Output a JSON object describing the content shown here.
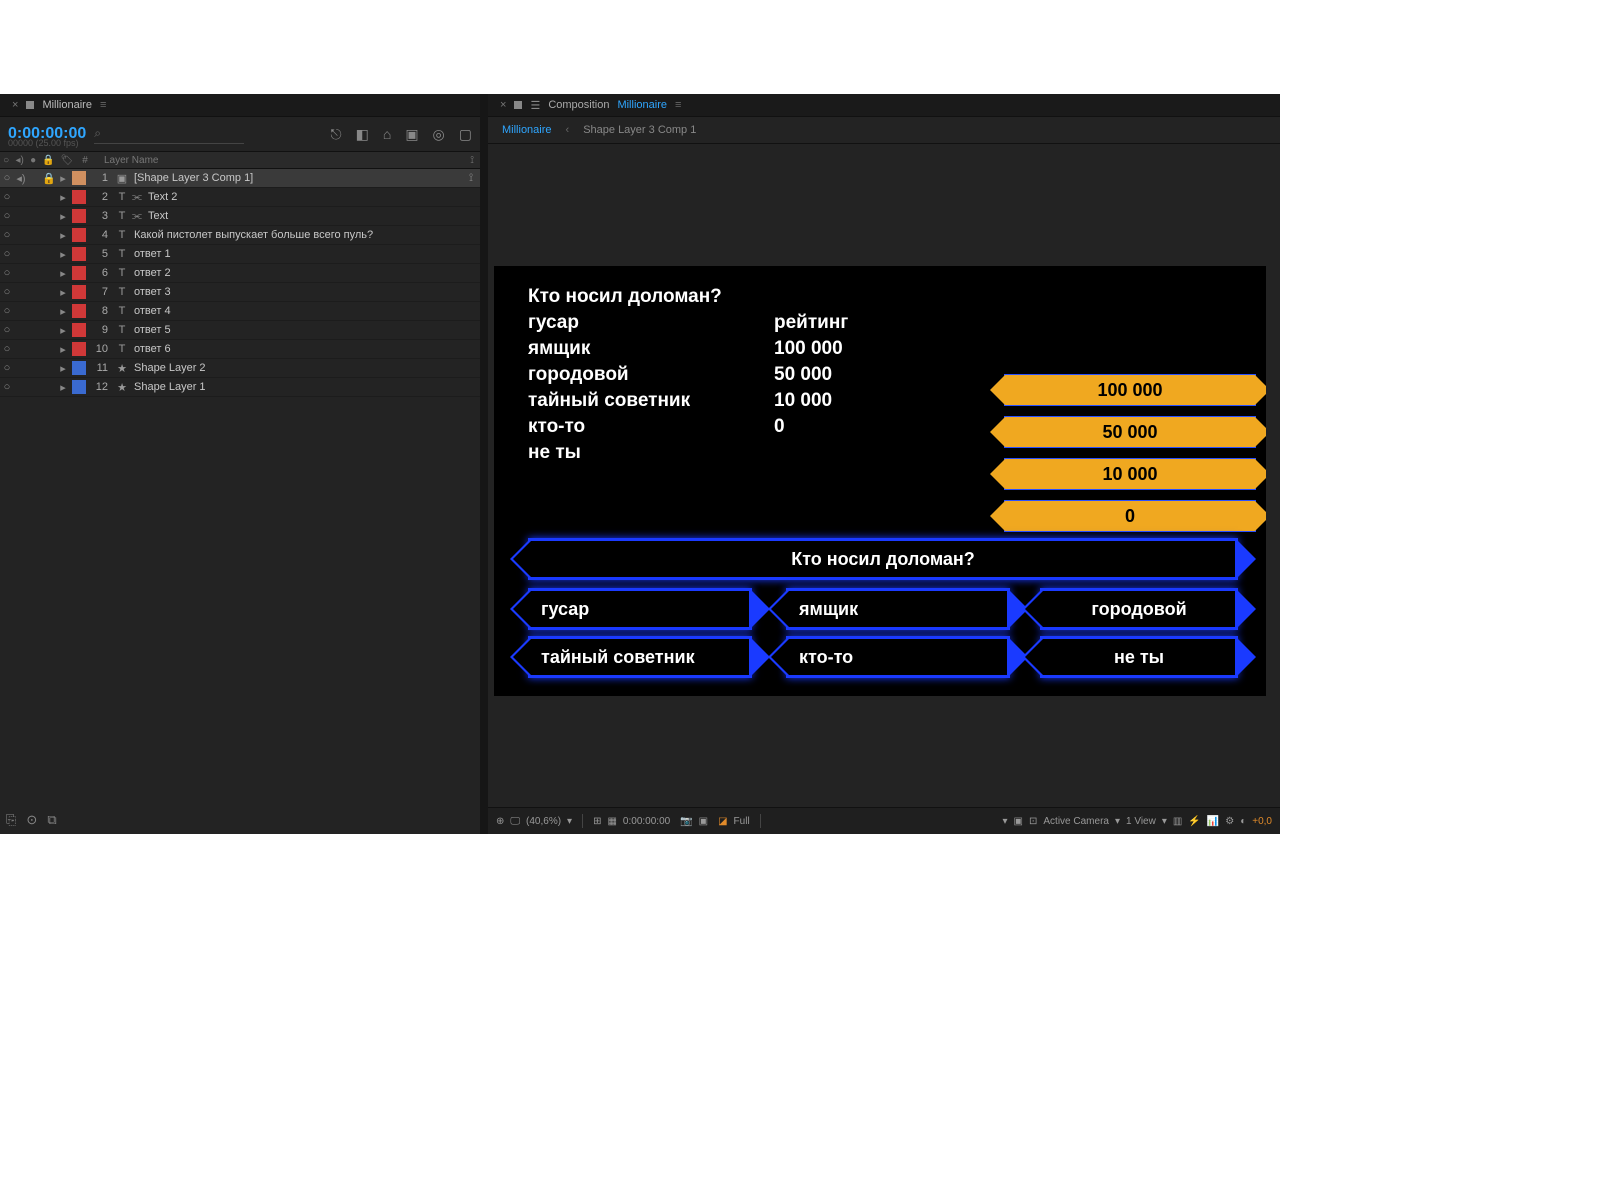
{
  "timeline": {
    "tab_name": "Millionaire",
    "timecode": "0:00:00:00",
    "fps": "00000 (25.00 fps)",
    "search_placeholder": "",
    "col_layer_name": "Layer Name",
    "col_idx": "#",
    "layers": [
      {
        "idx": "1",
        "name": "[Shape Layer 3 Comp 1]",
        "swatch": "sw-peach",
        "type": "comp",
        "link": ""
      },
      {
        "idx": "2",
        "name": "Text 2",
        "swatch": "sw-red",
        "type": "text",
        "link": "link"
      },
      {
        "idx": "3",
        "name": "Text",
        "swatch": "sw-red",
        "type": "text",
        "link": "link"
      },
      {
        "idx": "4",
        "name": "Какой пистолет выпускает больше всего пуль?",
        "swatch": "sw-red",
        "type": "text",
        "link": ""
      },
      {
        "idx": "5",
        "name": "ответ 1",
        "swatch": "sw-red",
        "type": "text",
        "link": ""
      },
      {
        "idx": "6",
        "name": "ответ 2",
        "swatch": "sw-red",
        "type": "text",
        "link": ""
      },
      {
        "idx": "7",
        "name": "ответ 3",
        "swatch": "sw-red",
        "type": "text",
        "link": ""
      },
      {
        "idx": "8",
        "name": "ответ 4",
        "swatch": "sw-red",
        "type": "text",
        "link": ""
      },
      {
        "idx": "9",
        "name": "ответ 5",
        "swatch": "sw-red",
        "type": "text",
        "link": ""
      },
      {
        "idx": "10",
        "name": "ответ 6",
        "swatch": "sw-red",
        "type": "text",
        "link": ""
      },
      {
        "idx": "11",
        "name": "Shape Layer 2",
        "swatch": "sw-blue",
        "type": "shape",
        "link": ""
      },
      {
        "idx": "12",
        "name": "Shape Layer 1",
        "swatch": "sw-blue",
        "type": "shape",
        "link": ""
      }
    ]
  },
  "composition": {
    "tab_prefix": "Composition",
    "tab_name": "Millionaire",
    "crumb_current": "Millionaire",
    "crumb_child": "Shape Layer 3 Comp 1"
  },
  "preview": {
    "question": "Кто носил доломан?",
    "rating_label": "рейтинг",
    "answers": [
      "гусар",
      "ямщик",
      "городовой",
      "тайный советник",
      "кто-то",
      "не ты"
    ],
    "ratings": [
      "100 000",
      "50 000",
      "10 000",
      "0"
    ],
    "ladder": [
      "100 000",
      "50 000",
      "10 000",
      "0"
    ],
    "question_box": "Кто носил доломан?",
    "grid": [
      "гусар",
      "ямщик",
      "городовой",
      "тайный советник",
      "кто-то",
      "не ты"
    ]
  },
  "footer": {
    "zoom": "(40,6%)",
    "time": "0:00:00:00",
    "res": "Full",
    "camera": "Active Camera",
    "view": "1 View",
    "exp": "+0,0"
  }
}
